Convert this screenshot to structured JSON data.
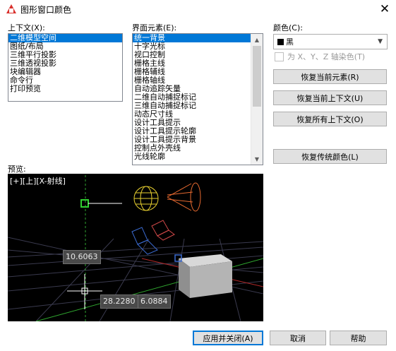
{
  "window": {
    "title": "图形窗口颜色",
    "close": "✕"
  },
  "context": {
    "label": "上下文(X):",
    "items": [
      "二维模型空间",
      "图纸/布局",
      "三维平行投影",
      "三维透视投影",
      "块编辑器",
      "命令行",
      "打印预览"
    ],
    "selected_index": 0
  },
  "elements": {
    "label": "界面元素(E):",
    "items": [
      "统一背景",
      "十字光标",
      "视口控制",
      "栅格主线",
      "栅格辅线",
      "栅格轴线",
      "自动追踪矢量",
      "二维自动捕捉标记",
      "三维自动捕捉标记",
      "动态尺寸线",
      "设计工具提示",
      "设计工具提示轮廓",
      "设计工具提示背景",
      "控制点外壳线",
      "光线轮廓"
    ],
    "selected_index": 0
  },
  "color": {
    "label": "颜色(C):",
    "value": "黑",
    "swatch": "#000000",
    "tint_label": "为 X、Y、Z 轴染色(T)",
    "tint_checked": false
  },
  "buttons": {
    "restore_element": "恢复当前元素(R)",
    "restore_context": "恢复当前上下文(U)",
    "restore_all": "恢复所有上下文(O)",
    "restore_classic": "恢复传统颜色(L)",
    "apply_close": "应用并关闭(A)",
    "cancel": "取消",
    "help": "帮助"
  },
  "preview": {
    "label": "预览:",
    "view_label": "[+][上][X-射线]",
    "dims": [
      "10.6063",
      "28.2280",
      "6.0884"
    ]
  }
}
